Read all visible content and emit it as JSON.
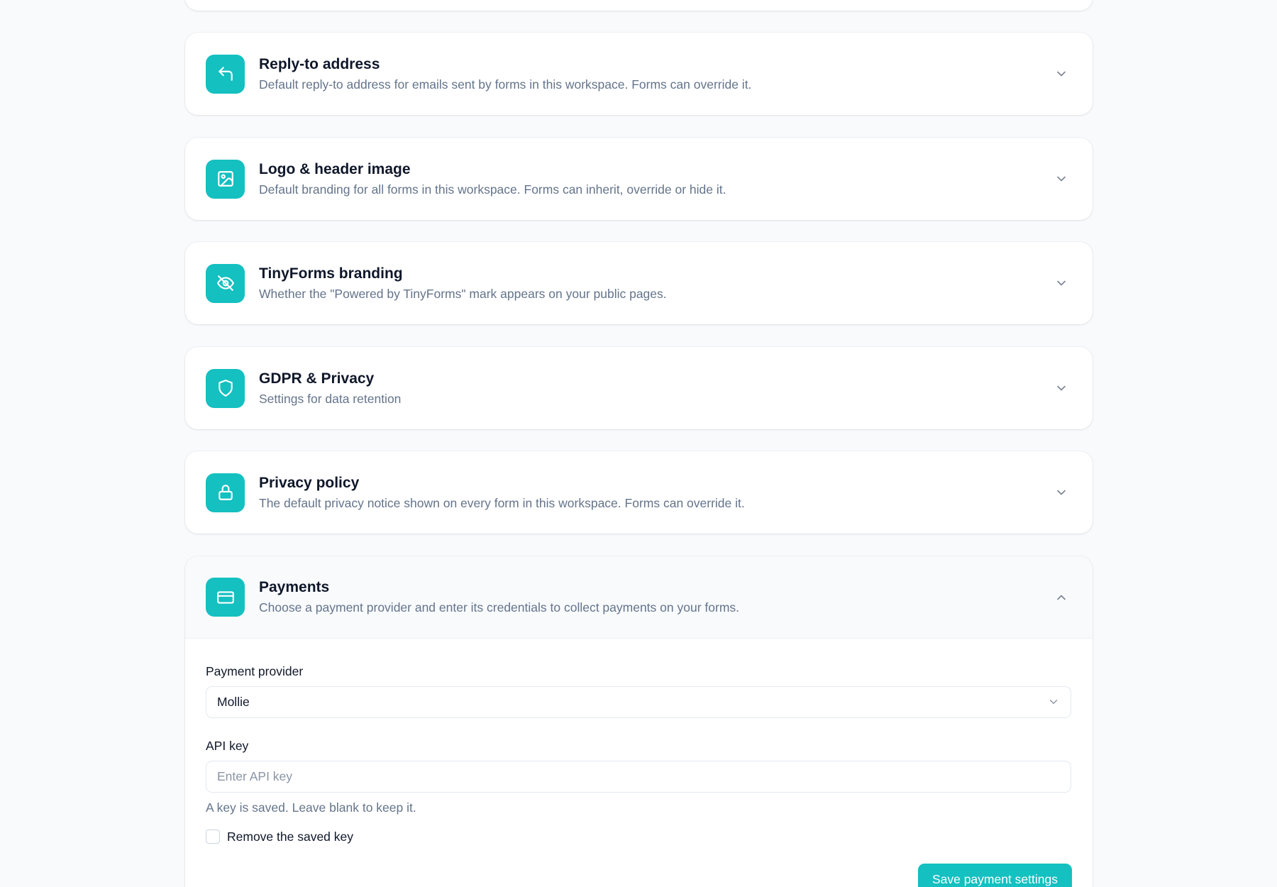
{
  "sections": [
    {
      "id": "reply-to",
      "icon": "reply-arrow-icon",
      "title": "Reply-to address",
      "description": "Default reply-to address for emails sent by forms in this workspace. Forms can override it.",
      "expanded": false
    },
    {
      "id": "logo",
      "icon": "image-icon",
      "title": "Logo & header image",
      "description": "Default branding for all forms in this workspace. Forms can inherit, override or hide it.",
      "expanded": false
    },
    {
      "id": "branding",
      "icon": "eye-off-icon",
      "title": "TinyForms branding",
      "description": "Whether the \"Powered by TinyForms\" mark appears on your public pages.",
      "expanded": false
    },
    {
      "id": "gdpr",
      "icon": "shield-icon",
      "title": "GDPR & Privacy",
      "description": "Settings for data retention",
      "expanded": false
    },
    {
      "id": "privacy-policy",
      "icon": "lock-icon",
      "title": "Privacy policy",
      "description": "The default privacy notice shown on every form in this workspace. Forms can override it.",
      "expanded": false
    },
    {
      "id": "payments",
      "icon": "credit-card-icon",
      "title": "Payments",
      "description": "Choose a payment provider and enter its credentials to collect payments on your forms.",
      "expanded": true
    }
  ],
  "payments": {
    "provider_label": "Payment provider",
    "provider_value": "Mollie",
    "api_key_label": "API key",
    "api_key_placeholder": "Enter API key",
    "api_key_help": "A key is saved. Leave blank to keep it.",
    "remove_key_label": "Remove the saved key",
    "remove_key_checked": false,
    "save_label": "Save payment settings"
  },
  "colors": {
    "accent": "#14c0c0",
    "background": "#f8fafc",
    "title": "#0f172a",
    "muted": "#64748b"
  }
}
